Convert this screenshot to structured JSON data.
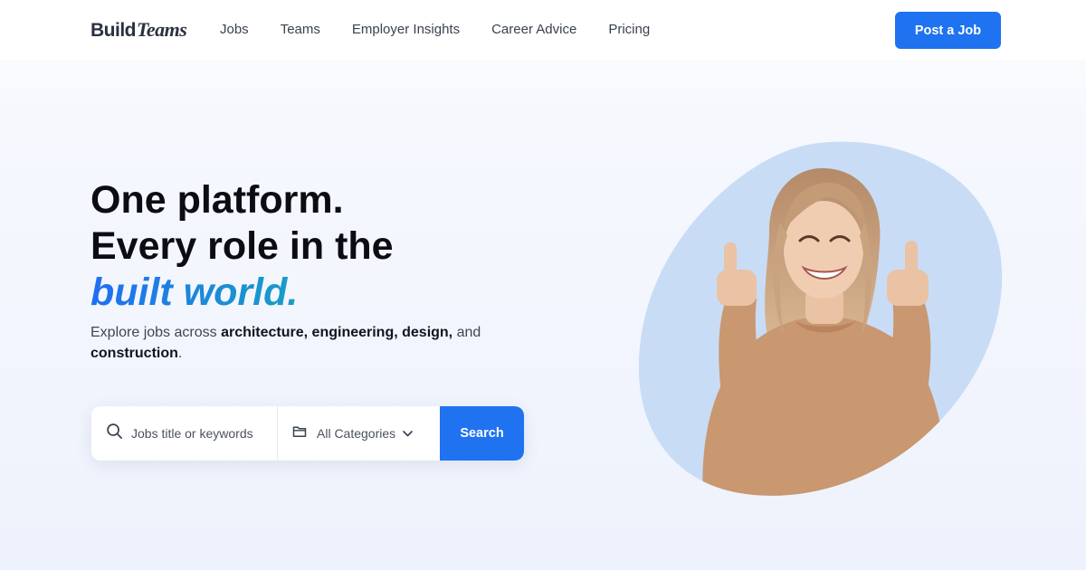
{
  "brand": {
    "word1": "Build",
    "word2": "Teams"
  },
  "nav": {
    "items": [
      "Jobs",
      "Teams",
      "Employer Insights",
      "Career Advice",
      "Pricing"
    ]
  },
  "header": {
    "cta_label": "Post a Job"
  },
  "hero": {
    "title_line1": "One platform.",
    "title_line2": "Every role in the",
    "title_accent": "built world.",
    "sub_prefix": "Explore jobs across ",
    "sub_b1": "architecture, engineering, design,",
    "sub_mid": " and ",
    "sub_b2": "construction",
    "sub_suffix": "."
  },
  "search": {
    "keyword_placeholder": "Jobs title or keywords",
    "category_value": "All Categories",
    "button_label": "Search"
  },
  "colors": {
    "primary": "#1f72f0",
    "blob": "#c8dcf6",
    "gradient_start": "#1f6ff2",
    "gradient_end": "#22c46e",
    "sweater": "#c99770"
  },
  "icons": {
    "search": "search-icon",
    "category": "folder-icon",
    "dropdown": "chevron-down-icon"
  }
}
